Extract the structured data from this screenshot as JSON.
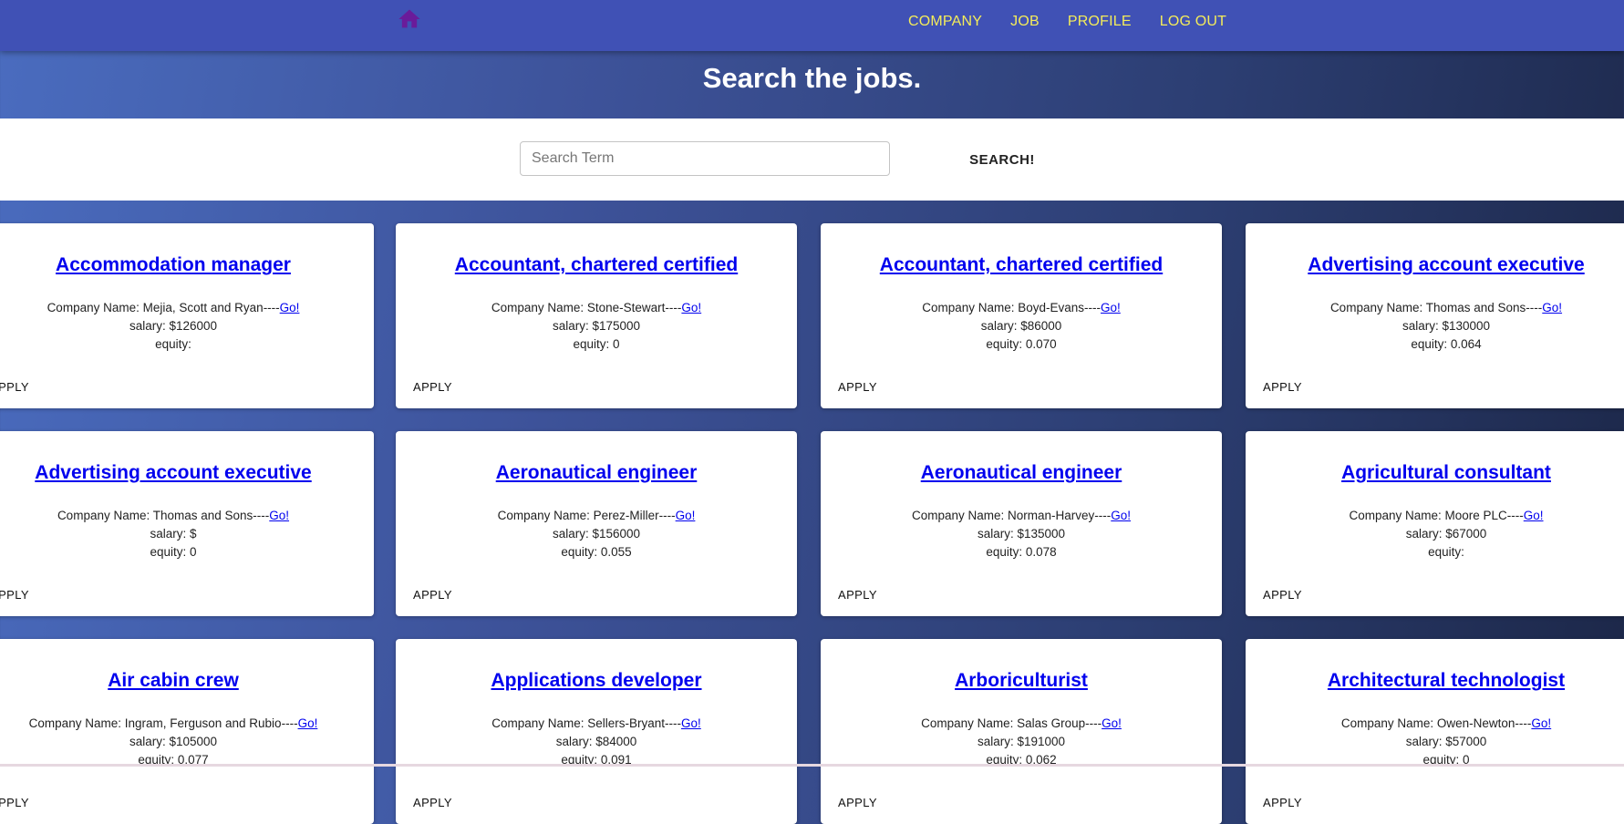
{
  "nav": {
    "home_icon": "home-icon",
    "home_color": "#6a1b9a",
    "links": [
      "COMPANY",
      "JOB",
      "PROFILE",
      "LOG OUT"
    ],
    "link_color": "#f4ec5a"
  },
  "hero": {
    "title": "Search the jobs."
  },
  "search": {
    "placeholder": "Search Term",
    "button_label": "SEARCH!"
  },
  "labels": {
    "company_prefix": "Company Name: ",
    "separator": "----",
    "go": "Go!",
    "salary_prefix": "salary: $",
    "equity_prefix": "equity: ",
    "apply": "APPLY"
  },
  "jobs": [
    {
      "title": "Accommodation manager",
      "company": "Mejia, Scott and Ryan",
      "salary": "126000",
      "equity": ""
    },
    {
      "title": "Accountant, chartered certified",
      "company": "Stone-Stewart",
      "salary": "175000",
      "equity": "0"
    },
    {
      "title": "Accountant, chartered certified",
      "company": "Boyd-Evans",
      "salary": "86000",
      "equity": "0.070"
    },
    {
      "title": "Advertising account executive",
      "company": "Thomas and Sons",
      "salary": "130000",
      "equity": "0.064"
    },
    {
      "title": "Advertising account executive",
      "company": "Thomas and Sons",
      "salary": "",
      "equity": "0"
    },
    {
      "title": "Aeronautical engineer",
      "company": "Perez-Miller",
      "salary": "156000",
      "equity": "0.055"
    },
    {
      "title": "Aeronautical engineer",
      "company": "Norman-Harvey",
      "salary": "135000",
      "equity": "0.078"
    },
    {
      "title": "Agricultural consultant",
      "company": "Moore PLC",
      "salary": "67000",
      "equity": ""
    },
    {
      "title": "Air cabin crew",
      "company": "Ingram, Ferguson and Rubio",
      "salary": "105000",
      "equity": "0.077"
    },
    {
      "title": "Applications developer",
      "company": "Sellers-Bryant",
      "salary": "84000",
      "equity": "0.091"
    },
    {
      "title": "Arboriculturist",
      "company": "Salas Group",
      "salary": "191000",
      "equity": "0.062"
    },
    {
      "title": "Architectural technologist",
      "company": "Owen-Newton",
      "salary": "57000",
      "equity": "0"
    }
  ]
}
